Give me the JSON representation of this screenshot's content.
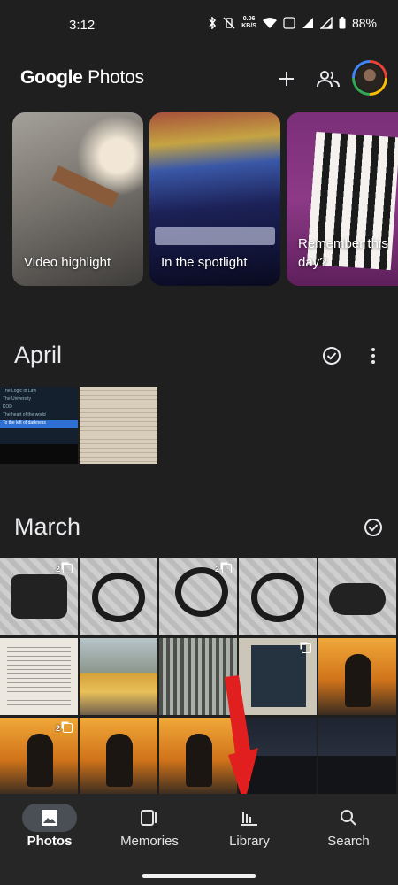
{
  "status_bar": {
    "time": "3:12",
    "net_speed_value": "0.06",
    "net_speed_unit": "KB/S",
    "battery": "88%"
  },
  "header": {
    "app_title_brand": "Google",
    "app_title_product": "Photos",
    "add_icon": "plus-icon",
    "share_icon": "people-icon"
  },
  "memories": [
    {
      "label": "Video highlight"
    },
    {
      "label": "In the spotlight"
    },
    {
      "label": "Remember this day?"
    }
  ],
  "sections": {
    "april": {
      "title": "April"
    },
    "march": {
      "title": "March"
    }
  },
  "april_thumbs": {
    "menu_lines": [
      "The Logic of Law",
      "The University",
      "KOD",
      "The heart of the world",
      "To the left of darkness"
    ]
  },
  "march_badges": {
    "pouch": "2",
    "headphone_side": "2",
    "stage_burst": "2"
  },
  "bottom_nav": {
    "items": [
      {
        "label": "Photos",
        "active": true,
        "icon": "photo-icon"
      },
      {
        "label": "Memories",
        "active": false,
        "icon": "memories-icon"
      },
      {
        "label": "Library",
        "active": false,
        "icon": "library-icon"
      },
      {
        "label": "Search",
        "active": false,
        "icon": "search-icon"
      }
    ]
  },
  "colors": {
    "background": "#1f1f1f",
    "nav_background": "#262626",
    "active_pill": "#4a4f55",
    "annotation_arrow": "#e11f1f"
  }
}
